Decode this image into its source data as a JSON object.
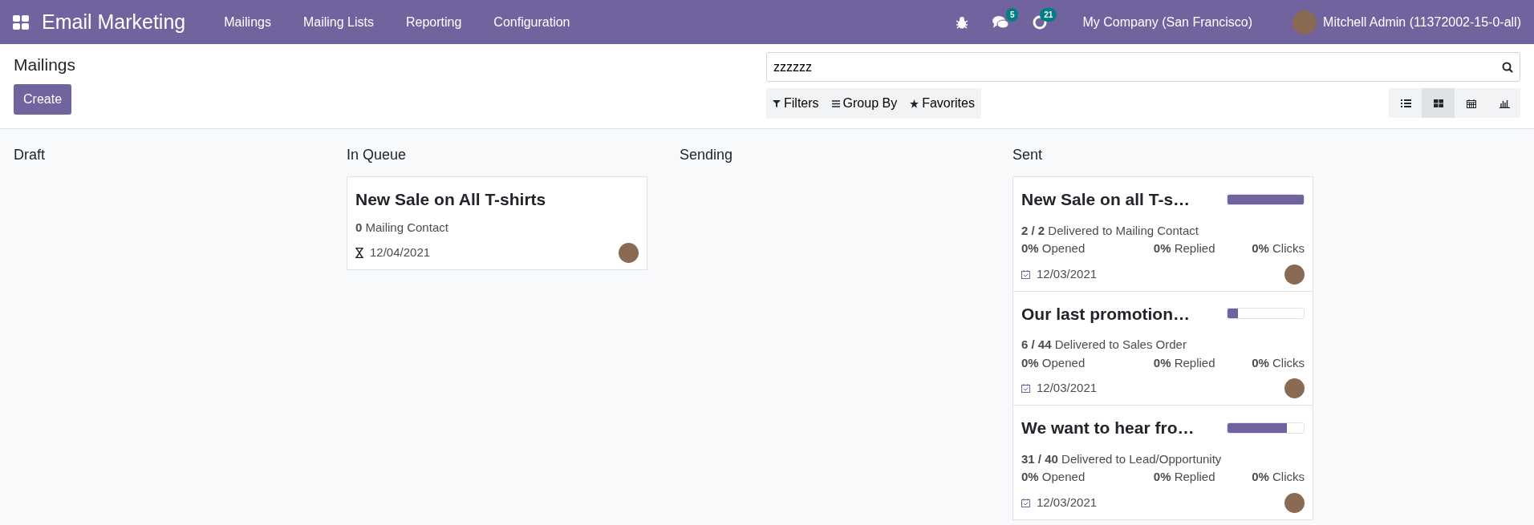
{
  "navbar": {
    "app_title": "Email Marketing",
    "menu": [
      "Mailings",
      "Mailing Lists",
      "Reporting",
      "Configuration"
    ],
    "messages_count": "5",
    "activities_count": "21",
    "company": "My Company (San Francisco)",
    "user": "Mitchell Admin (11372002-15-0-all)"
  },
  "control_panel": {
    "breadcrumb": "Mailings",
    "create_button": "Create",
    "search": {
      "value": "zzzzzz"
    },
    "filters": [
      "Filters",
      "Group By",
      "Favorites"
    ],
    "views": [
      {
        "kind": "list",
        "selected": false
      },
      {
        "kind": "kanban",
        "selected": true
      },
      {
        "kind": "calendar",
        "selected": false
      },
      {
        "kind": "graph",
        "selected": false
      }
    ]
  },
  "columns": [
    {
      "title": "Draft"
    },
    {
      "title": "In Queue",
      "cards": [
        {
          "kind": "queued",
          "title": "New Sale on All T-shirts",
          "recipients": "**0** Mailing Contact",
          "date": "12/04/2021"
        }
      ]
    },
    {
      "title": "Sending"
    },
    {
      "title": "Sent",
      "cards": [
        {
          "kind": "sent",
          "title": "New Sale on all T-s…",
          "level": 1.0,
          "delivered": "**2 / 2** Delivered to Mailing Contact",
          "stats": [
            "**0%** Opened",
            "**0%** Replied",
            "**0%** Clicks"
          ],
          "date": "12/03/2021"
        },
        {
          "kind": "sent",
          "title": "Our last promotion…",
          "level": 0.14,
          "delivered": "**6 / 44** Delivered to Sales Order",
          "stats": [
            "**0%** Opened",
            "**0%** Replied",
            "**0%** Clicks"
          ],
          "date": "12/03/2021"
        },
        {
          "kind": "sent",
          "title": "We want to hear fro…",
          "level": 0.775,
          "delivered": "**31 / 40** Delivered to Lead/Opportunity",
          "stats": [
            "**0%** Opened",
            "**0%** Replied",
            "**0%** Clicks"
          ],
          "date": "12/03/2021"
        }
      ]
    }
  ]
}
